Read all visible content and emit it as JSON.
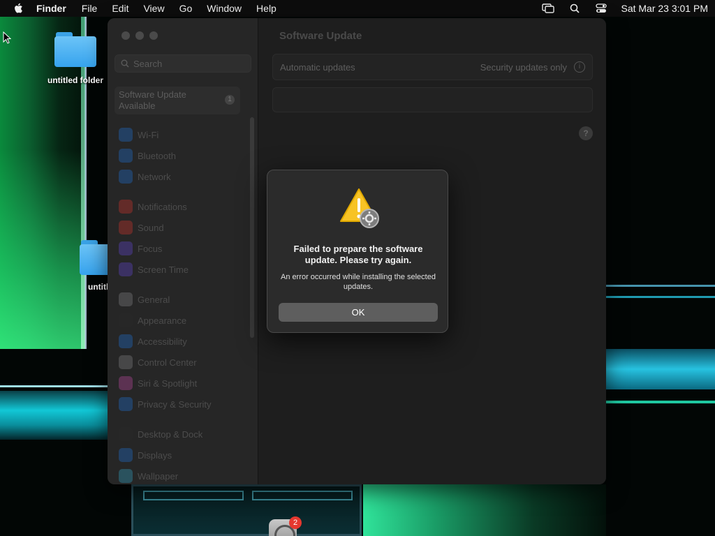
{
  "menubar": {
    "app_name": "Finder",
    "items": [
      "File",
      "Edit",
      "View",
      "Go",
      "Window",
      "Help"
    ],
    "clock": "Sat Mar 23  3:01 PM"
  },
  "desktop": {
    "folder1_label": "untitled folder",
    "folder2_label": "untitle"
  },
  "settings": {
    "search_placeholder": "Search",
    "update_item": {
      "label_line1": "Software Update",
      "label_line2": "Available",
      "badge": "1"
    },
    "sidebar_items": [
      {
        "label": "Wi-Fi",
        "color": "#1e7ae6"
      },
      {
        "label": "Bluetooth",
        "color": "#1e7ae6"
      },
      {
        "label": "Network",
        "color": "#1e7ae6"
      },
      {
        "label": "Notifications",
        "color": "#e5382f"
      },
      {
        "label": "Sound",
        "color": "#e5382f"
      },
      {
        "label": "Focus",
        "color": "#6b4ce6"
      },
      {
        "label": "Screen Time",
        "color": "#6b4ce6"
      },
      {
        "label": "General",
        "color": "#8e8e93"
      },
      {
        "label": "Appearance",
        "color": "#2b2b2b"
      },
      {
        "label": "Accessibility",
        "color": "#1e7ae6"
      },
      {
        "label": "Control Center",
        "color": "#8e8e93"
      },
      {
        "label": "Siri & Spotlight",
        "color": "#d14fb0"
      },
      {
        "label": "Privacy & Security",
        "color": "#1e7ae6"
      },
      {
        "label": "Desktop & Dock",
        "color": "#2b2b2b"
      },
      {
        "label": "Displays",
        "color": "#1e7ae6"
      },
      {
        "label": "Wallpaper",
        "color": "#35b0d8"
      }
    ],
    "title": "Software Update",
    "automatic_updates_label": "Automatic updates",
    "automatic_updates_value": "Security updates only",
    "info_glyph": "i",
    "help_glyph": "?"
  },
  "alert": {
    "title": "Failed to prepare the software update. Please try again.",
    "message": "An error occurred while installing the selected updates.",
    "ok_label": "OK"
  },
  "dock": {
    "badge_count": "2"
  }
}
